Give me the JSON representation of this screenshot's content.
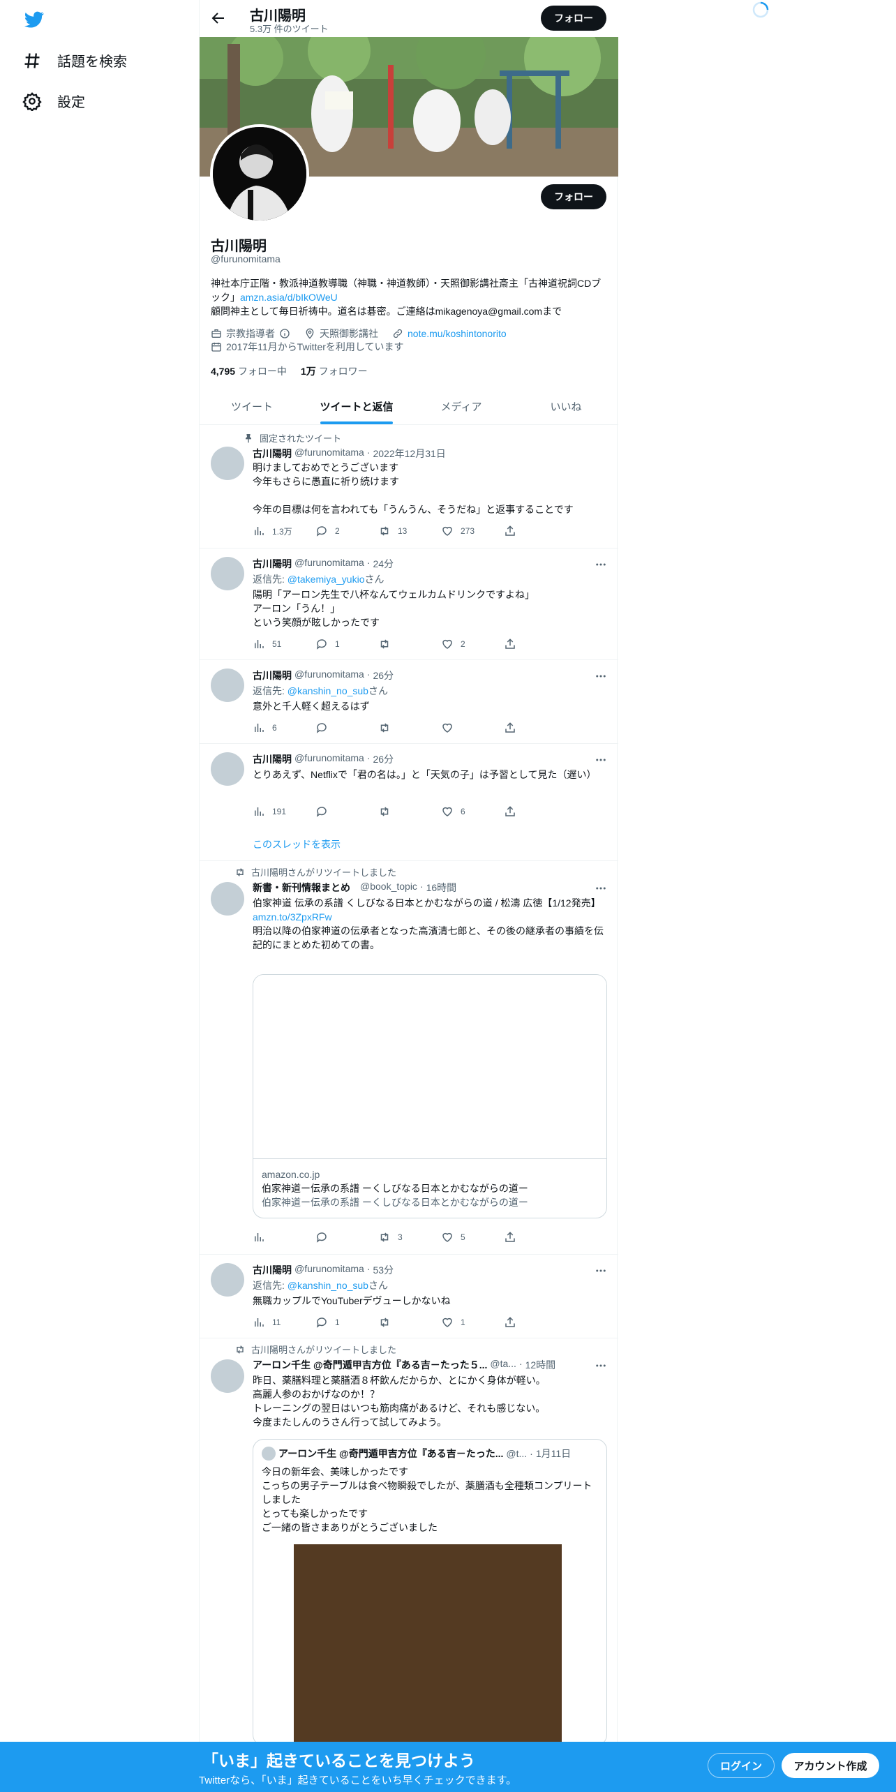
{
  "nav": {
    "explore": "話題を検索",
    "settings": "設定"
  },
  "header": {
    "title": "古川陽明",
    "tweet_count": "5.3万 件のツイート",
    "follow": "フォロー"
  },
  "profile": {
    "name": "古川陽明",
    "handle": "@furunomitama",
    "bio_line1": "神社本庁正階・教派神道教導職（神職・神道教師）・天照御影講社斎主「古神道祝詞CDブック」",
    "bio_link": "amzn.asia/d/bIkOWeU",
    "bio_line2": "顧問神主として毎日祈祷中。道名は碁密。ご連絡はmikagenoya@gmail.comまで",
    "category": "宗教指導者",
    "location": "天照御影講社",
    "website": "note.mu/koshintonorito",
    "joined": "2017年11月からTwitterを利用しています",
    "following_count": "4,795",
    "following_label": "フォロー中",
    "followers_count": "1万",
    "followers_label": "フォロワー",
    "follow": "フォロー"
  },
  "tabs": [
    "ツイート",
    "ツイートと返信",
    "メディア",
    "いいね"
  ],
  "tweets": {
    "t1": {
      "pinned": "固定されたツイート",
      "name": "古川陽明",
      "handle": "@furunomitama",
      "time": "2022年12月31日",
      "body": "明けましておめでとうございます\n今年もさらに愚直に祈り続けます\n\n今年の目標は何を言われても「うんうん、そうだね」と返事することです",
      "views": "1.3万",
      "replies": "2",
      "retweets": "13",
      "likes": "273"
    },
    "t2": {
      "name": "古川陽明",
      "handle": "@furunomitama",
      "time": "24分",
      "reply_prefix": "返信先: ",
      "reply_to": "@takemiya_yukio",
      "reply_suffix": "さん",
      "body": "陽明「アーロン先生で八杯なんてウェルカムドリンクですよね」\nアーロン「うん！」\nという笑顔が眩しかったです",
      "views": "51",
      "replies": "1",
      "retweets": "",
      "likes": "2"
    },
    "t3": {
      "name": "古川陽明",
      "handle": "@furunomitama",
      "time": "26分",
      "reply_prefix": "返信先: ",
      "reply_to": "@kanshin_no_sub",
      "reply_suffix": "さん",
      "body": "意外と千人軽く超えるはず",
      "views": "6",
      "replies": "",
      "retweets": "",
      "likes": ""
    },
    "t4": {
      "name": "古川陽明",
      "handle": "@furunomitama",
      "time": "26分",
      "body": "とりあえず、Netflixで「君の名は。」と「天気の子」は予習として見た（遅い）",
      "views": "191",
      "replies": "",
      "retweets": "",
      "likes": "6",
      "show_thread": "このスレッドを表示"
    },
    "t5": {
      "retweeted_by": "古川陽明さんがリツイートしました",
      "name": "新書・新刊情報まとめ",
      "handle": "@book_topic",
      "time": "16時間",
      "body": "伯家神道 伝承の系譜 くしびなる日本とかむながらの道 / 松濤 広徳【1/12発売】",
      "link": "amzn.to/3ZpxRFw",
      "body2": "明治以降の伯家神道の伝承者となった高濱清七郎と、その後の継承者の事績を伝記的にまとめた初めての書。",
      "card_domain": "amazon.co.jp",
      "card_title": "伯家神道ー伝承の系譜 ーくしびなる日本とかむながらの道ー",
      "card_desc": "伯家神道ー伝承の系譜 ーくしびなる日本とかむながらの道ー",
      "views": "",
      "replies": "",
      "retweets": "3",
      "likes": "5"
    },
    "t6": {
      "name": "古川陽明",
      "handle": "@furunomitama",
      "time": "53分",
      "reply_prefix": "返信先: ",
      "reply_to": "@kanshin_no_sub",
      "reply_suffix": "さん",
      "body": "無職カップルでYouTuberデヴューしかないね",
      "views": "11",
      "replies": "1",
      "retweets": "",
      "likes": "1"
    },
    "t7": {
      "retweeted_by": "古川陽明さんがリツイートしました",
      "name": "アーロン千生 @奇門遁甲吉方位『ある吉－たった５...",
      "handle": "@ta...",
      "time": "12時間",
      "body": "昨日、薬膳料理と薬膳酒８杯飲んだからか、とにかく身体が軽い。\n高麗人参のおかげなのか！？\nトレーニングの翌日はいつも筋肉痛があるけど、それも感じない。\n今度またしんのうさん行って試してみよう。",
      "quote_name": "アーロン千生 @奇門遁甲吉方位『ある吉－たった...",
      "quote_handle": "@t...",
      "quote_time": "1月11日",
      "quote_body": "今日の新年会、美味しかったです\nこっちの男子テーブルは食べ物瞬殺でしたが、薬膳酒も全種類コンプリートしました\nとっても楽しかったです\nご一緒の皆さまありがとうございました"
    }
  },
  "bottom": {
    "title": "「いま」起きていることを見つけよう",
    "subtitle": "Twitterなら、「いま」起きていることをいち早くチェックできます。",
    "login": "ログイン",
    "signup": "アカウント作成"
  },
  "colors": {
    "accent": "#1d9bf0",
    "text": "#0f1419",
    "muted": "#536471"
  }
}
